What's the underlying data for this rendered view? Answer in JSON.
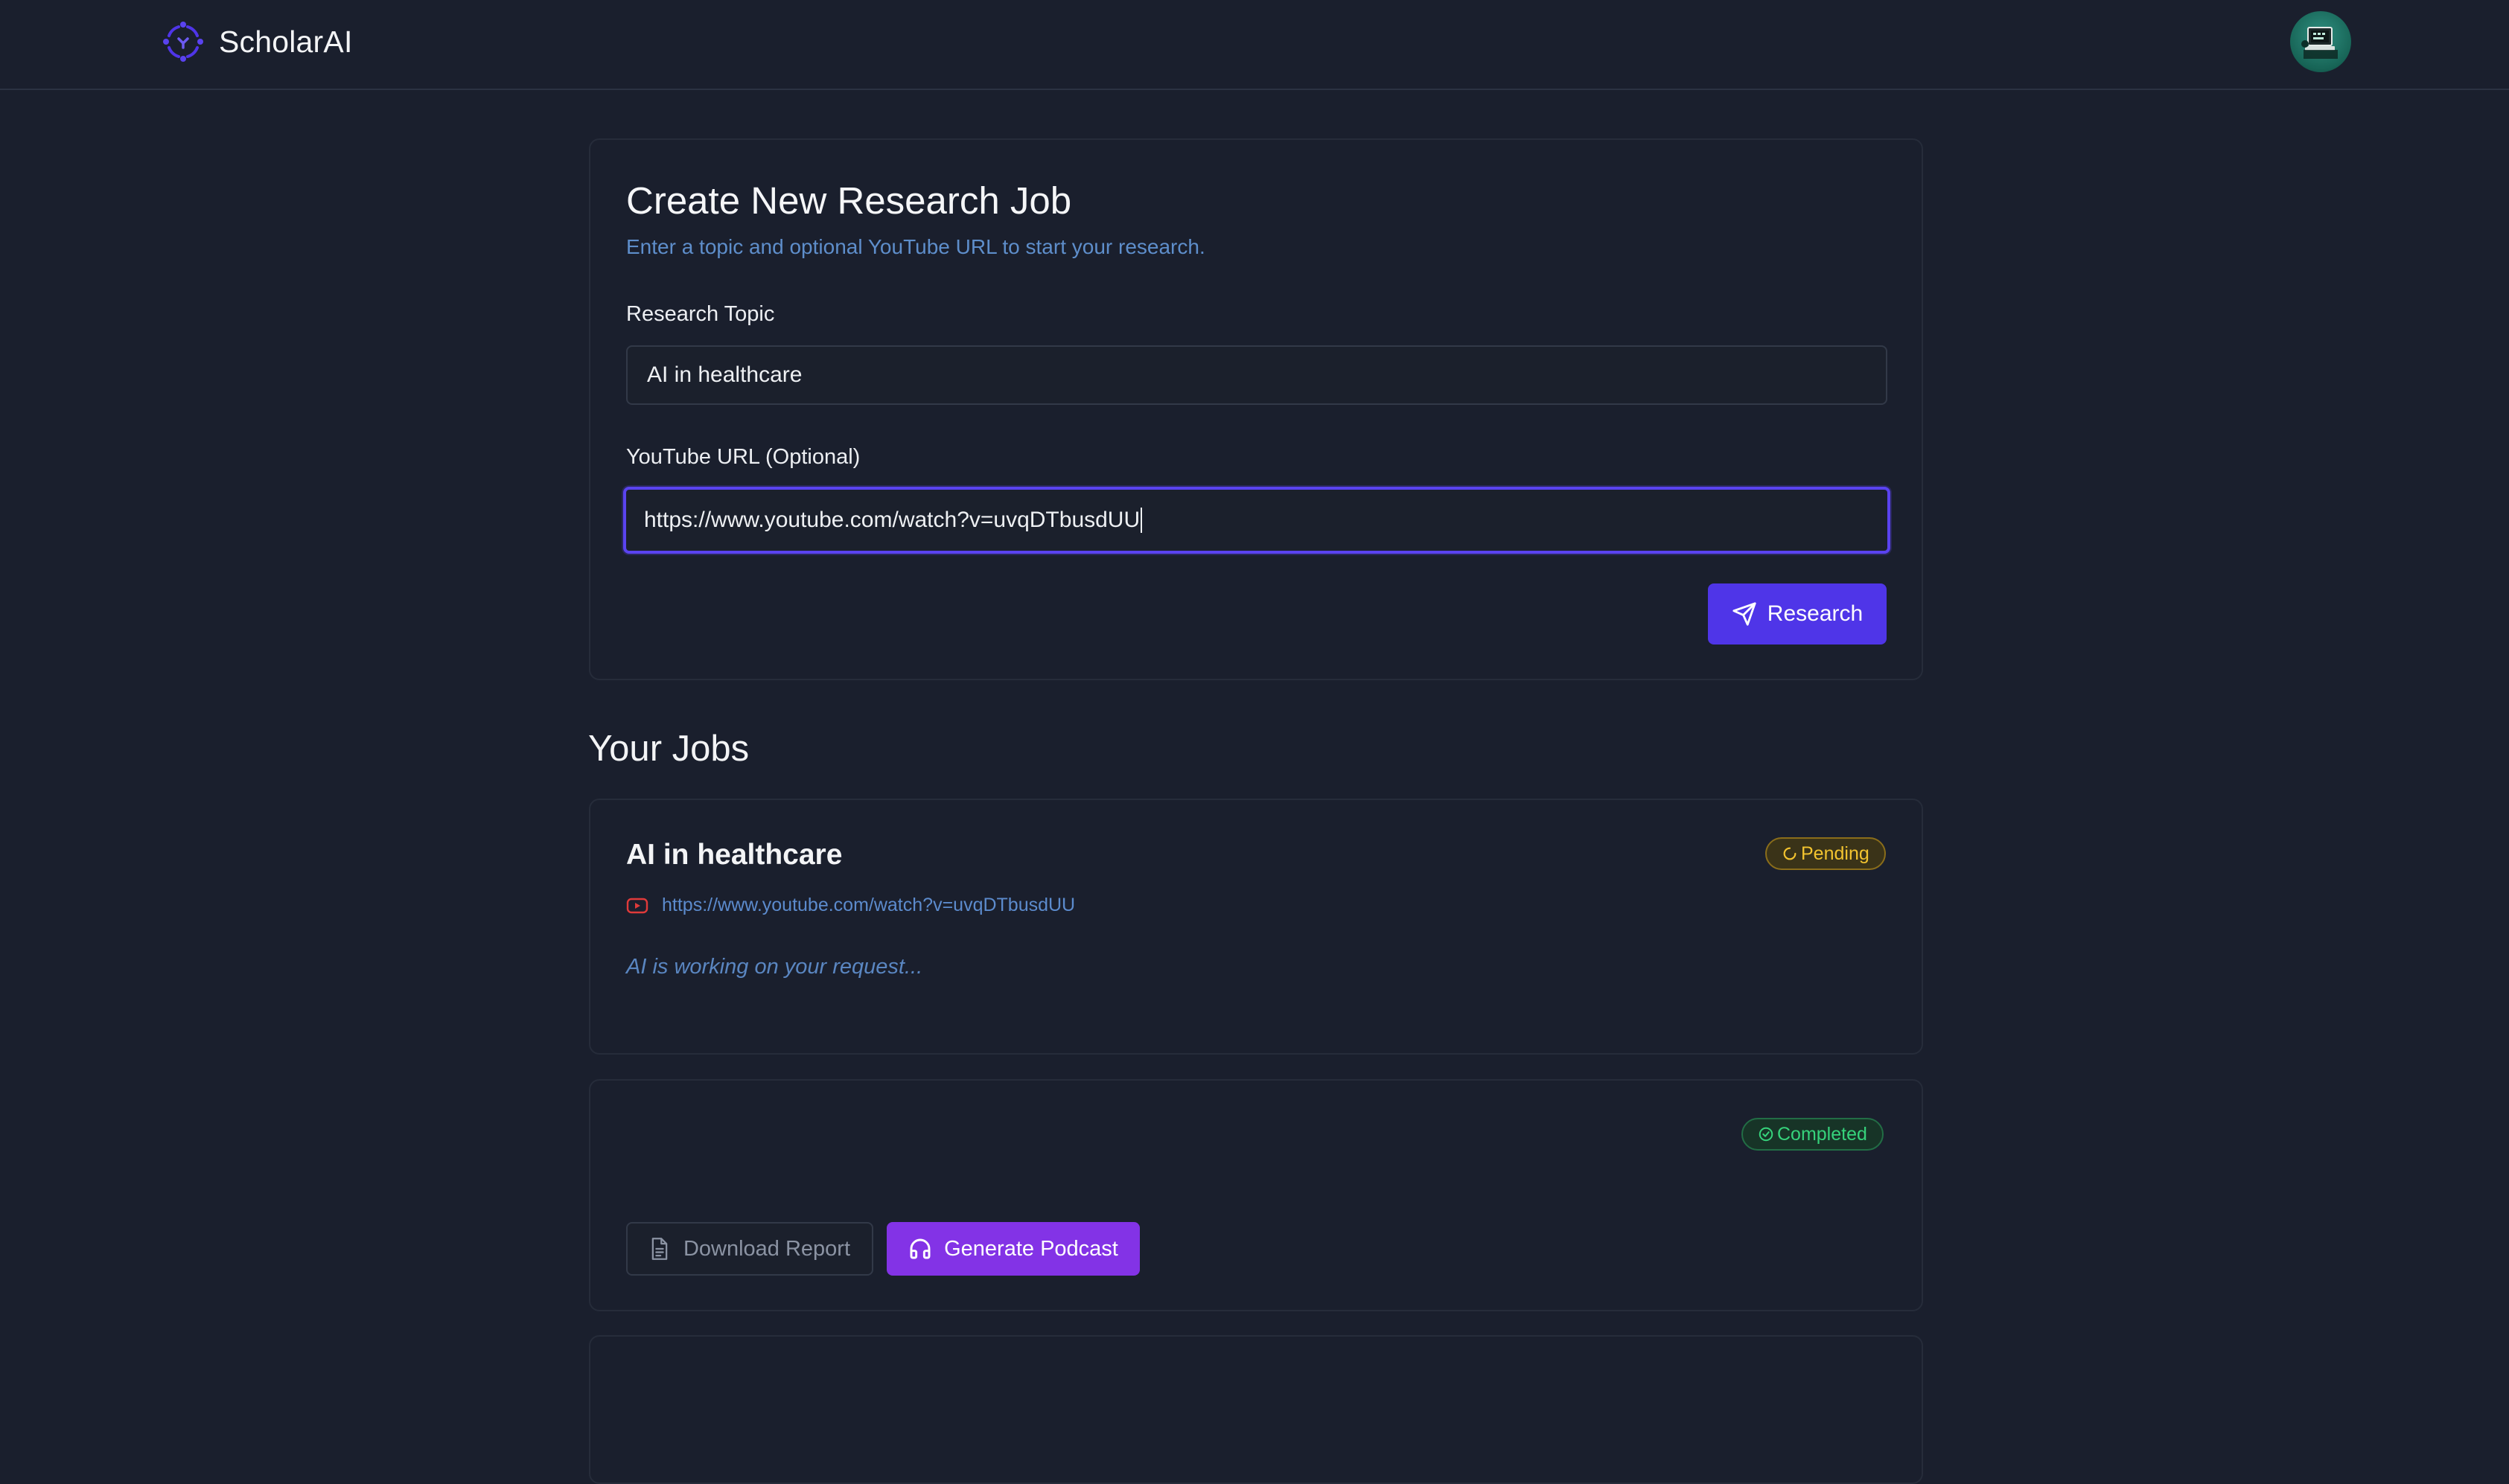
{
  "app": {
    "name": "ScholarAI"
  },
  "colors": {
    "accent": "#4f35e8",
    "podcast": "#8333e6",
    "pending": "#f2c32f",
    "completed": "#36d27b"
  },
  "create_form": {
    "title": "Create New Research Job",
    "subtitle": "Enter a topic and optional YouTube URL to start your research.",
    "topic_label": "Research Topic",
    "topic_value": "AI in healthcare",
    "url_label": "YouTube URL (Optional)",
    "url_value": "https://www.youtube.com/watch?v=uvqDTbusdUU",
    "submit_label": "Research",
    "submit_icon": "send-icon"
  },
  "jobs_section": {
    "title": "Your Jobs"
  },
  "jobs": [
    {
      "title": "AI in healthcare",
      "status": "Pending",
      "status_icon": "spinner-icon",
      "url": "https://www.youtube.com/watch?v=uvqDTbusdUU",
      "url_icon": "youtube-icon",
      "note": "AI is working on your request..."
    },
    {
      "title": "",
      "status": "Completed",
      "status_icon": "check-circle-icon",
      "actions": {
        "download_label": "Download Report",
        "download_icon": "file-icon",
        "podcast_label": "Generate Podcast",
        "podcast_icon": "headphones-icon"
      }
    }
  ]
}
